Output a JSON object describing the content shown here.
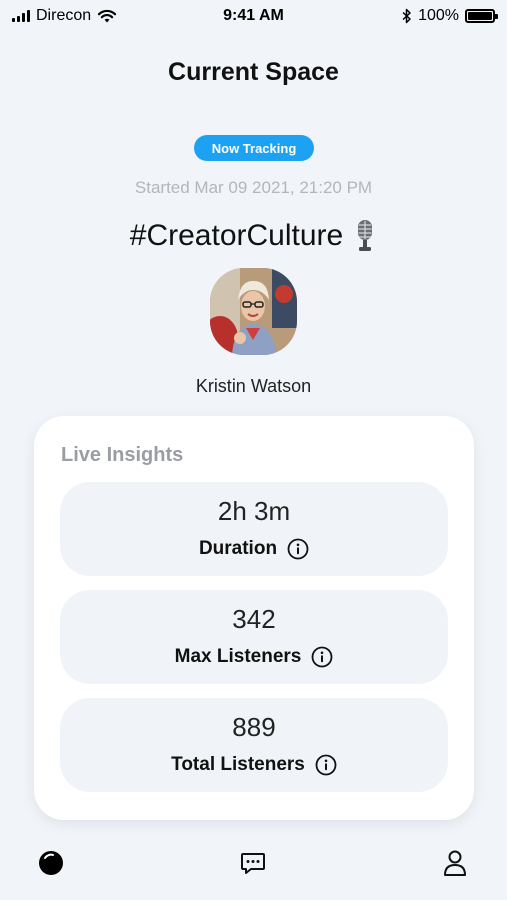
{
  "status_bar": {
    "carrier": "Direcon",
    "time": "9:41 AM",
    "battery": "100%",
    "icons": [
      "signal-icon",
      "wifi-icon",
      "bluetooth-icon",
      "battery-icon"
    ]
  },
  "header": {
    "title": "Current Space"
  },
  "space": {
    "status_badge": "Now Tracking",
    "started": "Started Mar 09 2021, 21:20 PM",
    "title": "#CreatorCulture",
    "title_icon": "microphone-icon",
    "host_name": "Kristin Watson"
  },
  "insights": {
    "label": "Live Insights",
    "metrics": [
      {
        "value": "2h 3m",
        "label": "Duration",
        "icon": "info-icon"
      },
      {
        "value": "342",
        "label": "Max Listeners",
        "icon": "info-icon"
      },
      {
        "value": "889",
        "label": "Total Listeners",
        "icon": "info-icon"
      }
    ]
  },
  "tab_bar": {
    "items": [
      {
        "icon": "spaces-icon",
        "active": true
      },
      {
        "icon": "chat-icon",
        "active": false
      },
      {
        "icon": "profile-icon",
        "active": false
      }
    ]
  },
  "colors": {
    "accent": "#1da1f2",
    "background": "#f1f5f9",
    "card": "#ffffff",
    "metric_bg": "#f0f4f8",
    "muted_text": "#b3b6ba"
  }
}
